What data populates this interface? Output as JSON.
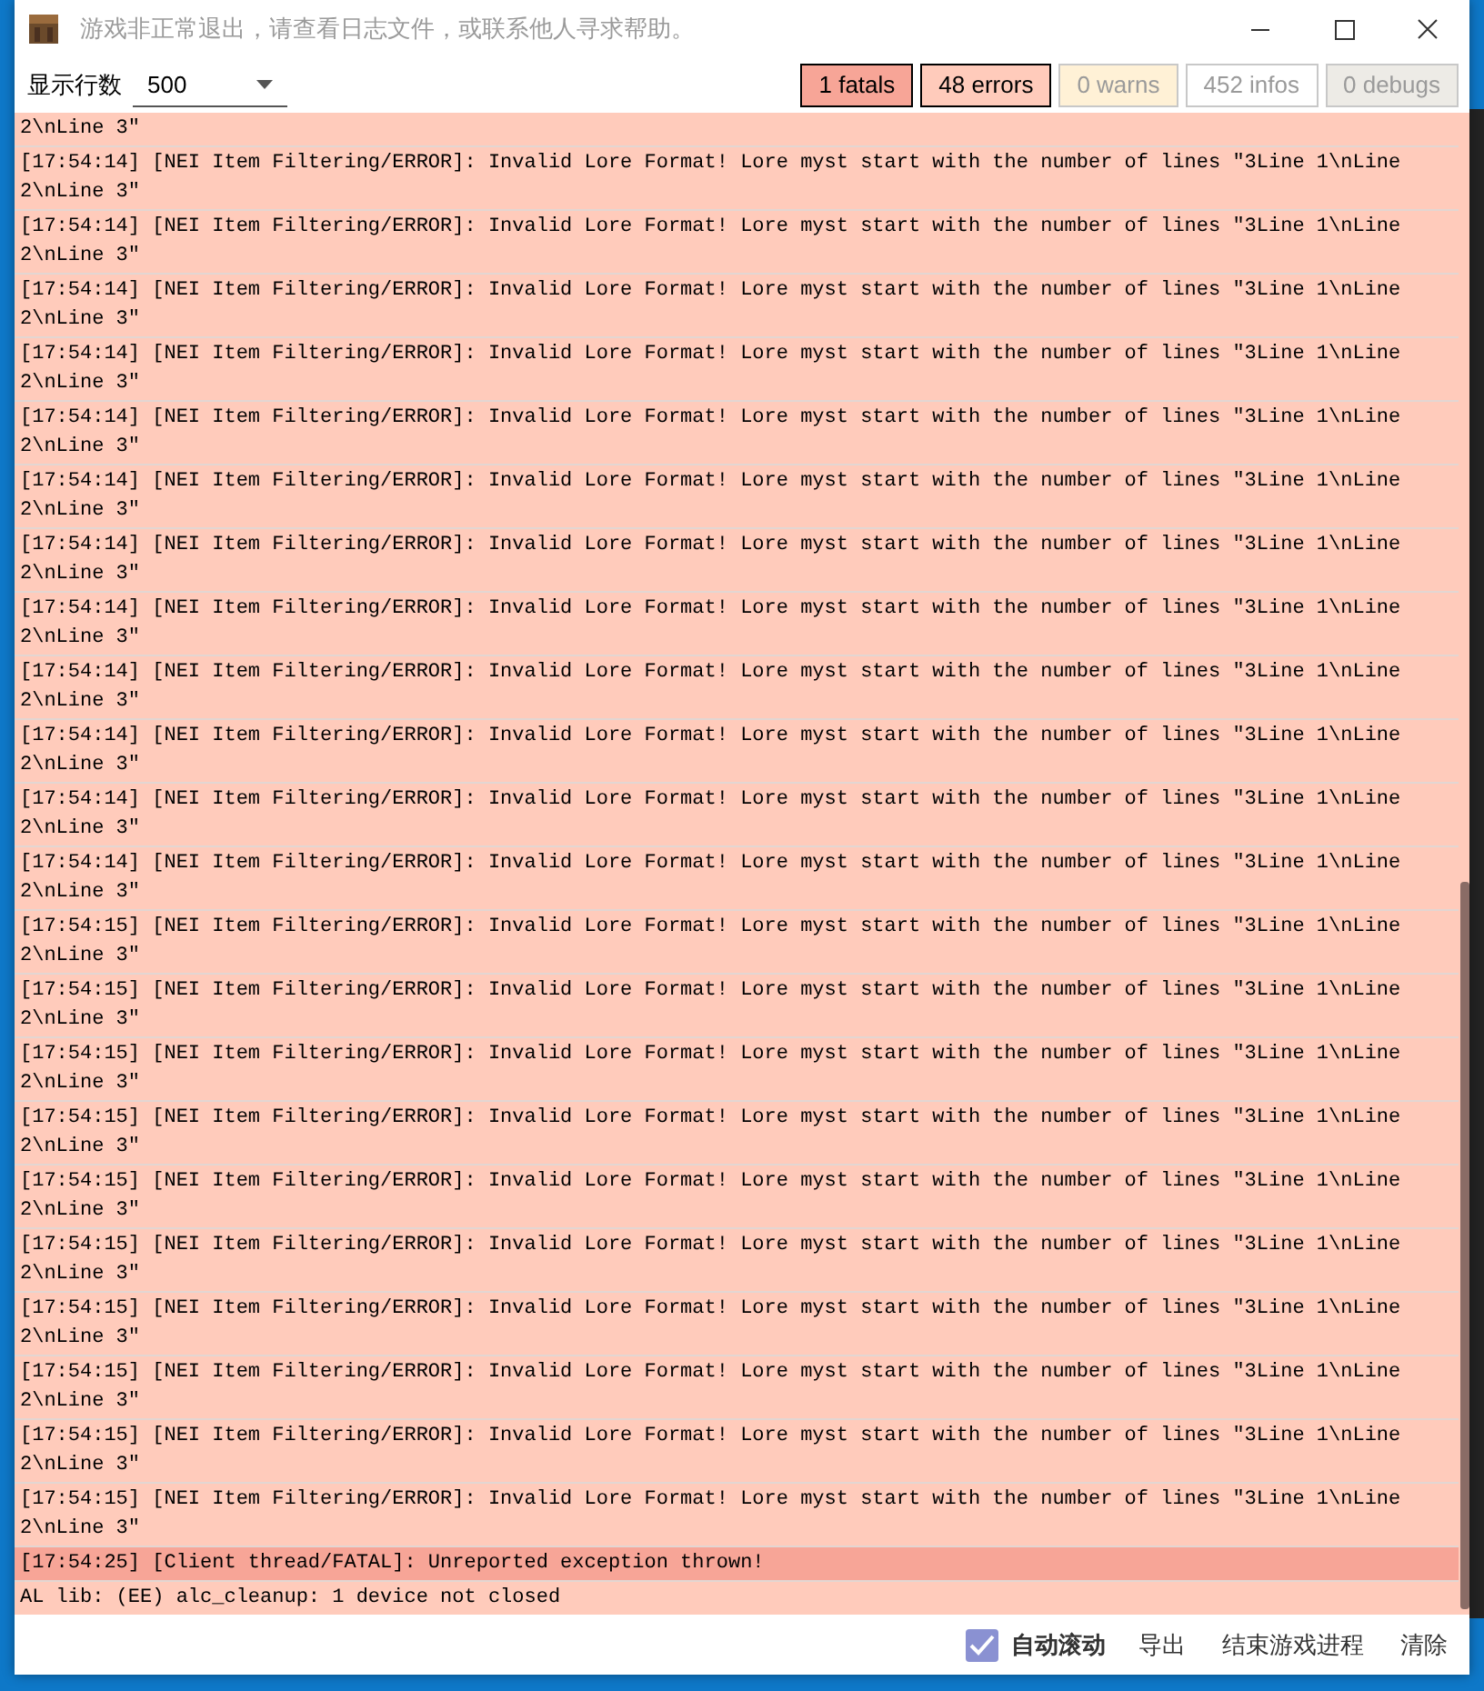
{
  "window": {
    "title": "游戏非正常退出，请查看日志文件，或联系他人寻求帮助。"
  },
  "display_rows": {
    "label": "显示行数",
    "value": "500"
  },
  "filters": [
    {
      "label": "1 fatals",
      "selected": true,
      "color": "#f7a597"
    },
    {
      "label": "48 errors",
      "selected": true,
      "color": "#ffcbbb"
    },
    {
      "label": "0 warns",
      "selected": false,
      "color": "#fff1d6"
    },
    {
      "label": "452 infos",
      "selected": false,
      "color": "#ffffff"
    },
    {
      "label": "0 debugs",
      "selected": false,
      "color": "#edebe6"
    }
  ],
  "log": [
    {
      "kind": "error",
      "text": "2\\nLine 3\""
    },
    {
      "kind": "error",
      "text": "[17:54:14] [NEI Item Filtering/ERROR]: Invalid Lore Format! Lore myst start with the number of lines \"3Line 1\\nLine 2\\nLine 3\""
    },
    {
      "kind": "error",
      "text": "[17:54:14] [NEI Item Filtering/ERROR]: Invalid Lore Format! Lore myst start with the number of lines \"3Line 1\\nLine 2\\nLine 3\""
    },
    {
      "kind": "error",
      "text": "[17:54:14] [NEI Item Filtering/ERROR]: Invalid Lore Format! Lore myst start with the number of lines \"3Line 1\\nLine 2\\nLine 3\""
    },
    {
      "kind": "error",
      "text": "[17:54:14] [NEI Item Filtering/ERROR]: Invalid Lore Format! Lore myst start with the number of lines \"3Line 1\\nLine 2\\nLine 3\""
    },
    {
      "kind": "error",
      "text": "[17:54:14] [NEI Item Filtering/ERROR]: Invalid Lore Format! Lore myst start with the number of lines \"3Line 1\\nLine 2\\nLine 3\""
    },
    {
      "kind": "error",
      "text": "[17:54:14] [NEI Item Filtering/ERROR]: Invalid Lore Format! Lore myst start with the number of lines \"3Line 1\\nLine 2\\nLine 3\""
    },
    {
      "kind": "error",
      "text": "[17:54:14] [NEI Item Filtering/ERROR]: Invalid Lore Format! Lore myst start with the number of lines \"3Line 1\\nLine 2\\nLine 3\""
    },
    {
      "kind": "error",
      "text": "[17:54:14] [NEI Item Filtering/ERROR]: Invalid Lore Format! Lore myst start with the number of lines \"3Line 1\\nLine 2\\nLine 3\""
    },
    {
      "kind": "error",
      "text": "[17:54:14] [NEI Item Filtering/ERROR]: Invalid Lore Format! Lore myst start with the number of lines \"3Line 1\\nLine 2\\nLine 3\""
    },
    {
      "kind": "error",
      "text": "[17:54:14] [NEI Item Filtering/ERROR]: Invalid Lore Format! Lore myst start with the number of lines \"3Line 1\\nLine 2\\nLine 3\""
    },
    {
      "kind": "error",
      "text": "[17:54:14] [NEI Item Filtering/ERROR]: Invalid Lore Format! Lore myst start with the number of lines \"3Line 1\\nLine 2\\nLine 3\""
    },
    {
      "kind": "error",
      "text": "[17:54:14] [NEI Item Filtering/ERROR]: Invalid Lore Format! Lore myst start with the number of lines \"3Line 1\\nLine 2\\nLine 3\""
    },
    {
      "kind": "error",
      "text": "[17:54:15] [NEI Item Filtering/ERROR]: Invalid Lore Format! Lore myst start with the number of lines \"3Line 1\\nLine 2\\nLine 3\""
    },
    {
      "kind": "error",
      "text": "[17:54:15] [NEI Item Filtering/ERROR]: Invalid Lore Format! Lore myst start with the number of lines \"3Line 1\\nLine 2\\nLine 3\""
    },
    {
      "kind": "error",
      "text": "[17:54:15] [NEI Item Filtering/ERROR]: Invalid Lore Format! Lore myst start with the number of lines \"3Line 1\\nLine 2\\nLine 3\""
    },
    {
      "kind": "error",
      "text": "[17:54:15] [NEI Item Filtering/ERROR]: Invalid Lore Format! Lore myst start with the number of lines \"3Line 1\\nLine 2\\nLine 3\""
    },
    {
      "kind": "error",
      "text": "[17:54:15] [NEI Item Filtering/ERROR]: Invalid Lore Format! Lore myst start with the number of lines \"3Line 1\\nLine 2\\nLine 3\""
    },
    {
      "kind": "error",
      "text": "[17:54:15] [NEI Item Filtering/ERROR]: Invalid Lore Format! Lore myst start with the number of lines \"3Line 1\\nLine 2\\nLine 3\""
    },
    {
      "kind": "error",
      "text": "[17:54:15] [NEI Item Filtering/ERROR]: Invalid Lore Format! Lore myst start with the number of lines \"3Line 1\\nLine 2\\nLine 3\""
    },
    {
      "kind": "error",
      "text": "[17:54:15] [NEI Item Filtering/ERROR]: Invalid Lore Format! Lore myst start with the number of lines \"3Line 1\\nLine 2\\nLine 3\""
    },
    {
      "kind": "error",
      "text": "[17:54:15] [NEI Item Filtering/ERROR]: Invalid Lore Format! Lore myst start with the number of lines \"3Line 1\\nLine 2\\nLine 3\""
    },
    {
      "kind": "error",
      "text": "[17:54:15] [NEI Item Filtering/ERROR]: Invalid Lore Format! Lore myst start with the number of lines \"3Line 1\\nLine 2\\nLine 3\""
    },
    {
      "kind": "fatal",
      "text": "[17:54:25] [Client thread/FATAL]: Unreported exception thrown!"
    },
    {
      "kind": "error",
      "text": "AL lib: (EE) alc_cleanup: 1 device not closed"
    }
  ],
  "auto_scroll": {
    "label": "自动滚动",
    "checked": true
  },
  "actions": [
    "导出",
    "结束游戏进程",
    "清除"
  ]
}
